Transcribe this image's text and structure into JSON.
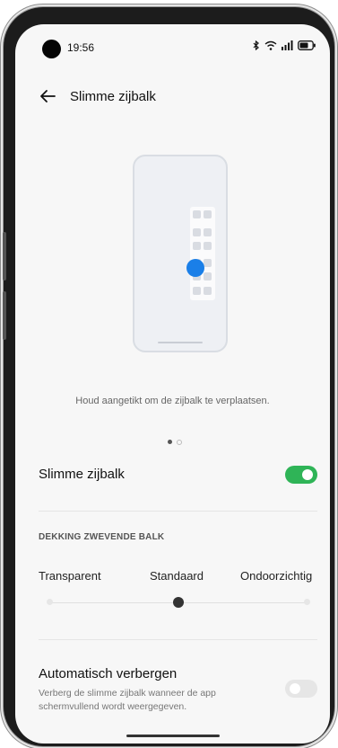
{
  "status_bar": {
    "time": "19:56",
    "icons": [
      "bluetooth-icon",
      "wifi-icon",
      "signal-icon",
      "battery-icon"
    ]
  },
  "header": {
    "back_icon": "arrow-left-icon",
    "title": "Slimme zijbalk"
  },
  "illustration": {
    "accent_color": "#1a7fe8",
    "hint": "Houd aangetikt om de zijbalk te verplaatsen.",
    "page_count": 2,
    "active_page": 1
  },
  "smart_sidebar": {
    "label": "Slimme zijbalk",
    "enabled": true,
    "accent_color": "#2fb457"
  },
  "opacity": {
    "section_title": "DEKKING ZWEVENDE BALK",
    "options": [
      "Transparent",
      "Standaard",
      "Ondoorzichtig"
    ],
    "selected": "Standaard"
  },
  "auto_hide": {
    "label": "Automatisch verbergen",
    "description": "Verberg de slimme zijbalk wanneer de app schermvullend wordt weergegeven.",
    "enabled": false
  }
}
